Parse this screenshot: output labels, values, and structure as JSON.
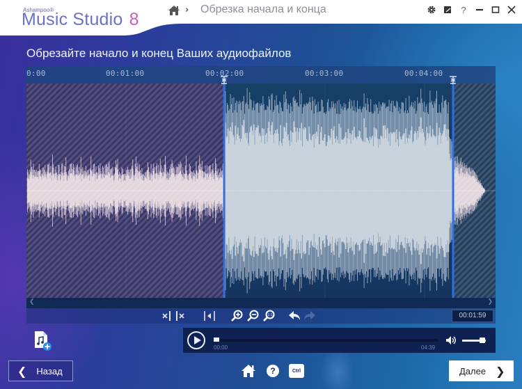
{
  "app": {
    "brand_small": "Ashampoo®",
    "brand_name": "Music Studio",
    "brand_version": "8"
  },
  "breadcrumb": {
    "home_icon": "home-icon",
    "separator": "›",
    "title": "Обрезка начала и конца"
  },
  "window_controls": [
    {
      "name": "settings",
      "icon": "gear-icon"
    },
    {
      "name": "feedback",
      "icon": "note-icon"
    },
    {
      "name": "help",
      "icon": "help-icon",
      "glyph": "?"
    },
    {
      "name": "minimize",
      "icon": "minimize-icon"
    },
    {
      "name": "maximize",
      "icon": "maximize-icon"
    },
    {
      "name": "close",
      "icon": "close-icon"
    }
  ],
  "heading": "Обрезайте начало и конец Ваших аудиофайлов",
  "timeline": {
    "ticks": [
      "0:00",
      "00:01:00",
      "00:02:00",
      "00:03:00",
      "00:04:00"
    ],
    "tick_seconds": [
      0,
      60,
      120,
      180,
      240
    ],
    "total_seconds": 279,
    "trim_start_seconds": 119,
    "trim_end_seconds": 257
  },
  "toolbar": {
    "tools": [
      {
        "name": "set-start",
        "icon": "trim-start-icon"
      },
      {
        "name": "set-end",
        "icon": "trim-end-icon"
      },
      {
        "name": "play-selection",
        "icon": "play-selection-icon"
      },
      {
        "name": "zoom-in",
        "icon": "zoom-in-icon"
      },
      {
        "name": "zoom-out",
        "icon": "zoom-out-icon"
      },
      {
        "name": "zoom-fit",
        "icon": "zoom-fit-icon"
      },
      {
        "name": "undo",
        "icon": "undo-icon"
      },
      {
        "name": "redo",
        "icon": "redo-icon",
        "disabled": true
      }
    ],
    "position_time": "00:01:59"
  },
  "player": {
    "current_time": "00:00",
    "total_time": "04:39",
    "progress": 0.0,
    "volume": 0.85
  },
  "footer": {
    "back_label": "Назад",
    "next_label": "Далее",
    "ctrl_label": "Ctrl",
    "help_glyph": "?"
  },
  "colors": {
    "selection_marker": "#2f6fe0",
    "waveform_selected": "#c9d3dc",
    "waveform_trimmed": "#e2d6dc",
    "next_button_bg": "#ffffff"
  }
}
